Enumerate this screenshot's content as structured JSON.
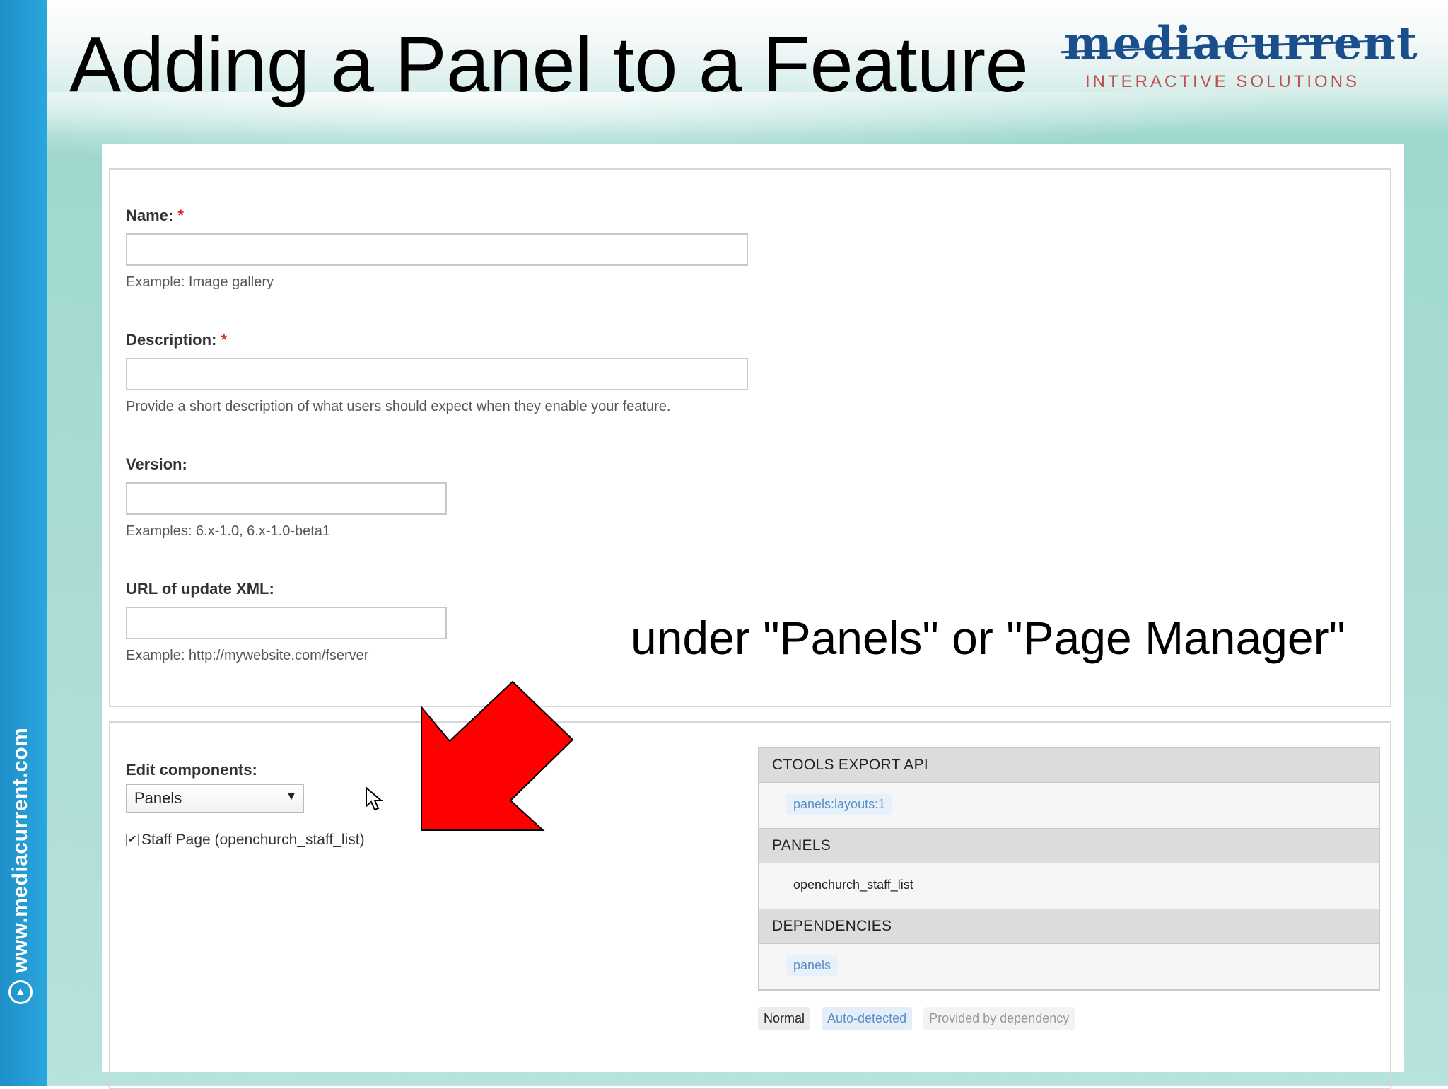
{
  "slide": {
    "title": "Adding a Panel to a Feature",
    "annotation": "under \"Panels\" or \"Page Manager\"",
    "sidebar_url": "www.mediacurrent.com"
  },
  "logo": {
    "word": "mediacurrent",
    "tagline": "INTERACTIVE SOLUTIONS"
  },
  "form": {
    "name": {
      "label": "Name:",
      "required": "*",
      "value": "",
      "hint": "Example: Image gallery"
    },
    "description": {
      "label": "Description:",
      "required": "*",
      "value": "",
      "hint": "Provide a short description of what users should expect when they enable your feature."
    },
    "version": {
      "label": "Version:",
      "value": "",
      "hint": "Examples: 6.x-1.0, 6.x-1.0-beta1"
    },
    "update_url": {
      "label": "URL of update XML:",
      "value": "",
      "hint": "Example: http://mywebsite.com/fserver"
    }
  },
  "components": {
    "label": "Edit components:",
    "selected": "Panels",
    "item": {
      "checked": true,
      "label": "Staff Page (openchurch_staff_list)"
    }
  },
  "export": {
    "groups": [
      {
        "heading": "CTOOLS EXPORT API",
        "item": "panels:layouts:1",
        "status": "auto"
      },
      {
        "heading": "PANELS",
        "item": "openchurch_staff_list",
        "status": "normal"
      },
      {
        "heading": "DEPENDENCIES",
        "item": "panels",
        "status": "auto"
      }
    ],
    "legend": {
      "normal": "Normal",
      "auto": "Auto-detected",
      "dependency": "Provided by dependency"
    }
  },
  "colors": {
    "sidebar_blue": "#2aa6de",
    "logo_blue": "#1a4f8c",
    "logo_red": "#c0504d",
    "arrow_red": "#ff0000",
    "required_red": "#e3261b",
    "auto_chip_text": "#5b8ec2"
  }
}
